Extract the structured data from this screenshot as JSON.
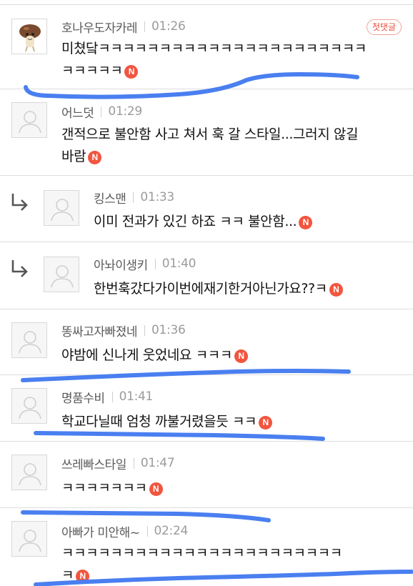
{
  "comments": [
    {
      "author": "호나우도자카레",
      "time": "01:26",
      "line1": "미쳤닼ㅋㅋㅋㅋㅋㅋㅋㅋㅋㅋㅋㅋㅋㅋㅋㅋㅋㅋㅋㅋㅋㅋ",
      "line2": "ㅋㅋㅋㅋㅋ",
      "badge": "첫댓글",
      "new_mark": "N"
    },
    {
      "author": "어느덧",
      "time": "01:29",
      "line1": "갠적으로 불안함 사고 쳐서 훅 갈 스타일...그러지 않길",
      "line2": "바람",
      "new_mark": "N"
    },
    {
      "author": "킹스맨",
      "time": "01:33",
      "line1": "이미 전과가 있긴 하죠 ㅋㅋ 불안함...",
      "new_mark": "N"
    },
    {
      "author": "아놔이생키",
      "time": "01:40",
      "line1": "한번훅갔다가이번에재기한거아닌가요??ㅋ",
      "new_mark": "N"
    },
    {
      "author": "똥싸고자빠졌네",
      "time": "01:36",
      "line1": "야밤에 신나게 웃었네요 ㅋㅋㅋ",
      "new_mark": "N"
    },
    {
      "author": "명품수비",
      "time": "01:41",
      "line1": "학교다닐때 엄청 까불거렸을듯 ㅋㅋ",
      "new_mark": "N"
    },
    {
      "author": "쓰레빠스타일",
      "time": "01:47",
      "line1": "ㅋㅋㅋㅋㅋㅋㅋ",
      "new_mark": "N"
    },
    {
      "author": "아빠가 미안해~",
      "time": "02:24",
      "line1": "ㅋㅋㅋㅋㅋㅋㅋㅋㅋㅋㅋㅋㅋㅋㅋㅋㅋㅋㅋㅋㅋㅋㅋ",
      "line2": "ㅋ",
      "new_mark": "N"
    }
  ],
  "colors": {
    "badge_red": "#f2553f",
    "highlight_stroke": "#4a7ff0",
    "divider": "#dddddd"
  },
  "icons": {
    "reply": "reply-arrow-icon",
    "default_avatar": "default-profile-icon",
    "mushroom_avatar": "mushroom-character-icon"
  }
}
